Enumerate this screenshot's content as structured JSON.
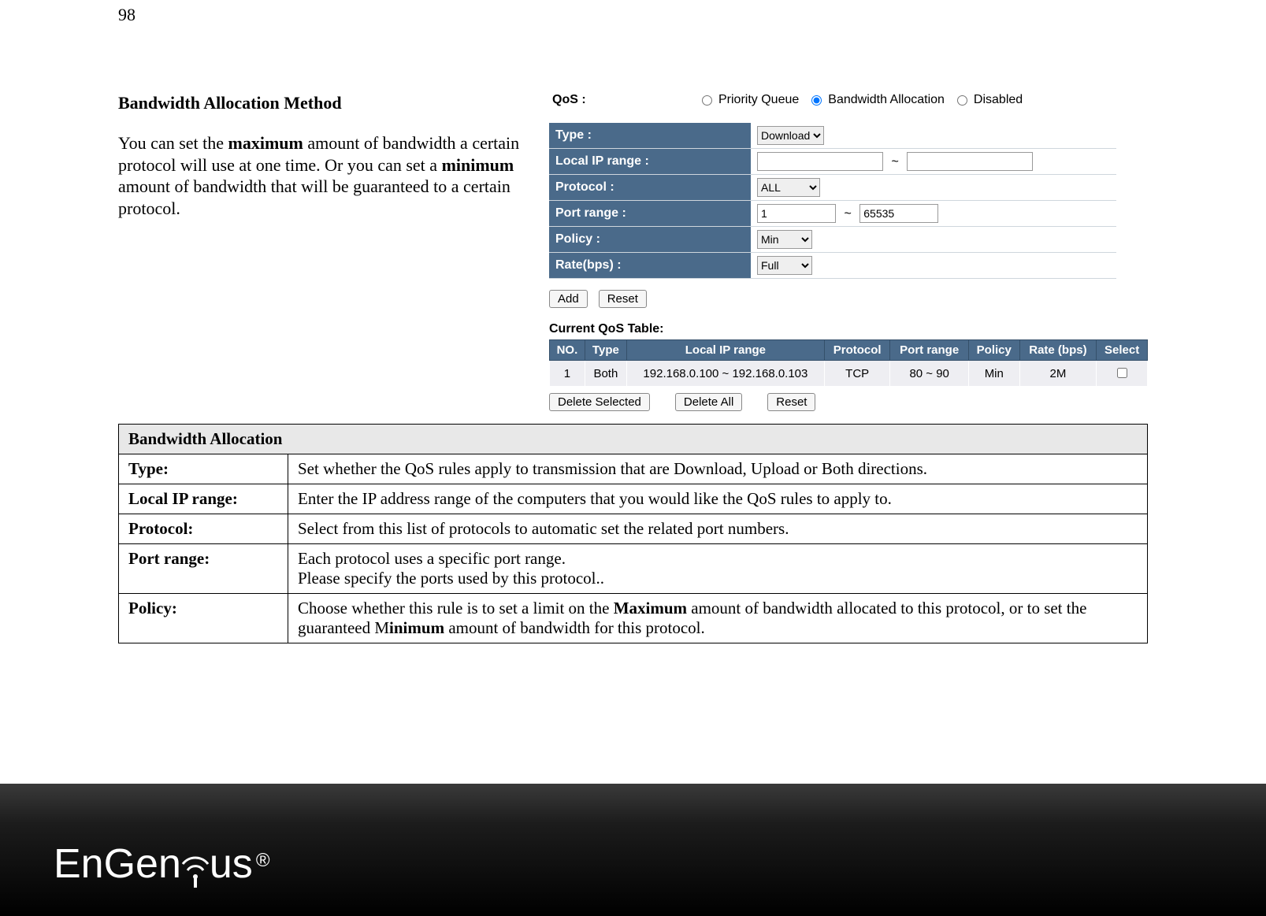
{
  "page_number": "98",
  "left": {
    "heading": "Bandwidth Allocation Method",
    "p_a": "You can set the ",
    "p_b": "maximum",
    "p_c": " amount of bandwidth a certain protocol will use at one time. Or you can set a ",
    "p_d": "minimum",
    "p_e": " amount of bandwidth that will be guaranteed to a certain protocol."
  },
  "shot": {
    "qos_label": "QoS :",
    "r1": "Priority Queue",
    "r2": "Bandwidth Allocation",
    "r3": "Disabled",
    "form": {
      "type_label": "Type :",
      "type_value": "Download",
      "localip_label": "Local IP range :",
      "localip_sep": "~",
      "protocol_label": "Protocol :",
      "protocol_value": "ALL",
      "port_label": "Port range :",
      "port_from": "1",
      "port_sep": "~",
      "port_to": "65535",
      "policy_label": "Policy :",
      "policy_value": "Min",
      "rate_label": "Rate(bps) :",
      "rate_value": "Full"
    },
    "btn_add": "Add",
    "btn_reset": "Reset",
    "current_title": "Current QoS Table:",
    "th": {
      "no": "NO.",
      "type": "Type",
      "ip": "Local IP range",
      "proto": "Protocol",
      "port": "Port range",
      "policy": "Policy",
      "rate": "Rate (bps)",
      "sel": "Select"
    },
    "row": {
      "no": "1",
      "type": "Both",
      "ip": "192.168.0.100 ~ 192.168.0.103",
      "proto": "TCP",
      "port": "80 ~ 90",
      "policy": "Min",
      "rate": "2M"
    },
    "btn_del_sel": "Delete Selected",
    "btn_del_all": "Delete All",
    "btn_reset2": "Reset"
  },
  "desc": {
    "header": "Bandwidth Allocation",
    "rows": [
      {
        "k": "Type:",
        "v": "Set whether the QoS rules apply to transmission that are Download, Upload or Both directions."
      },
      {
        "k": "Local IP range:",
        "v": "Enter the IP address range of the computers that you would like the QoS rules to apply to."
      },
      {
        "k": "Protocol:",
        "v": "Select from this list of protocols to automatic set the related port numbers."
      },
      {
        "k": "Port range:",
        "v_a": "Each protocol uses a specific port range.",
        "v_b": "Please specify the ports used by this protocol.."
      },
      {
        "k": "Policy:",
        "v_a": "Choose whether this rule is to set a limit on the ",
        "v_b": "Maximum",
        "v_c": " amount of bandwidth allocated to this protocol, or to set the guaranteed M",
        "v_d": "inimum",
        "v_e": " amount of bandwidth for this protocol."
      }
    ]
  },
  "logo": {
    "part1": "EnGen",
    "part2": "us",
    "reg": "®"
  }
}
